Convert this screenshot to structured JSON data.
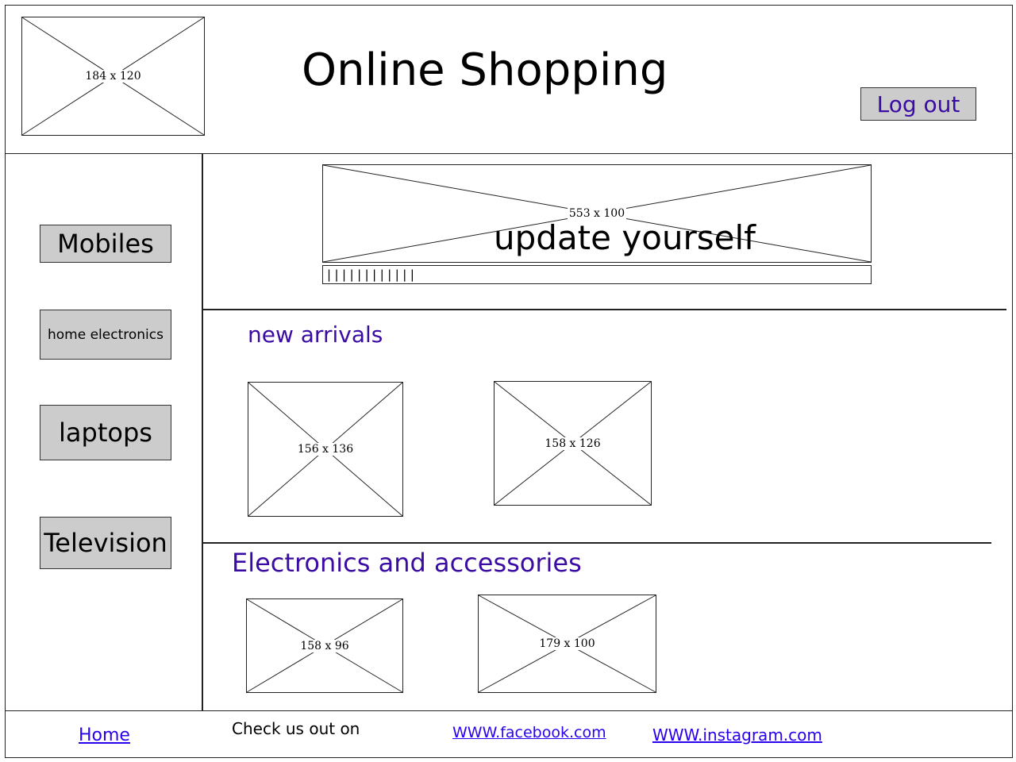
{
  "header": {
    "title": "Online Shopping",
    "logo_placeholder": "184 x 120",
    "logout_label": "Log out"
  },
  "sidebar": {
    "items": [
      {
        "label": "Mobiles"
      },
      {
        "label": "home electronics"
      },
      {
        "label": "laptops"
      },
      {
        "label": "Television"
      }
    ]
  },
  "banner": {
    "placeholder": "553 x 100",
    "text": "update yourself",
    "progress_text": "||||||||||||",
    "progress": 0.12
  },
  "new_arrivals": {
    "title": "new arrivals",
    "images": [
      "156 x 136",
      "158 x 126"
    ]
  },
  "electronics": {
    "title": "Electronics and accessories",
    "images": [
      "158 x 96",
      "179 x 100"
    ]
  },
  "footer": {
    "home": "Home",
    "check_us": "Check us out on",
    "facebook": "WWW.facebook.com",
    "instagram": "WWW.instagram.com"
  },
  "colors": {
    "button_fill": "#cccccc",
    "heading_accent": "#3a0ca3",
    "link": "#2a00ee"
  }
}
